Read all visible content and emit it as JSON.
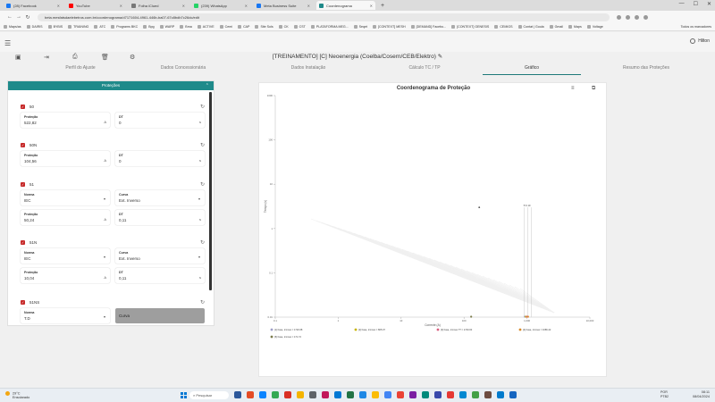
{
  "browser": {
    "tabs": [
      {
        "label": "(28) Facebook",
        "color": "#1877f2",
        "active": false
      },
      {
        "label": "YouTube",
        "color": "#ff0000",
        "active": false
      },
      {
        "label": "Folha iClued",
        "color": "#777777",
        "active": false
      },
      {
        "label": "(239) WhatsApp",
        "color": "#25d366",
        "active": false
      },
      {
        "label": "Meta Business Suite",
        "color": "#1877f2",
        "active": false
      },
      {
        "label": "Coordenograma",
        "color": "#1f8a8a",
        "active": true
      }
    ],
    "url": "beta.mesfatsdaelebetros.com.br/coordenograma/d7171604-4961-446b-ba07-67c8bdb7c26dc/edit",
    "bookmarks": [
      "Maps/as",
      "DAIRIS",
      "BYBIS",
      "TRAINING",
      "ATC",
      "Programs BKC",
      "Bpg",
      "WARP",
      "Bma",
      "ACTIVE",
      "Cemi",
      "CAP",
      "Site Sols",
      "CK",
      "CST",
      "PLATAFORMA MEG...",
      "Seqet",
      "[CONTEXT] MESH",
      "[DEMAND] Facebo...",
      "[CONTEXT] GENESIS",
      "CEMIGS",
      "Contat | Goula",
      "Gmail",
      "Maps",
      "Voltage"
    ],
    "bookmarks_right": "Todos os marcadores"
  },
  "app": {
    "user": "Hilton",
    "project_title": "[TREINAMENTO] [C] Neoenergia (Coelba/Cosern/CEB/Elektro)",
    "tabs": [
      {
        "label": "Perfil do Ajuste",
        "active": false
      },
      {
        "label": "Dados Concessionária",
        "active": false
      },
      {
        "label": "Dados Instalação",
        "active": false
      },
      {
        "label": "Cálculo TC / TP",
        "active": false
      },
      {
        "label": "Gráfico",
        "active": true
      },
      {
        "label": "Resumo das Proteções",
        "active": false
      }
    ]
  },
  "panel": {
    "title": "Proteções",
    "sections": [
      {
        "name": "50",
        "fields": [
          {
            "label": "Proteção",
            "value": "522,82",
            "unit": "A"
          },
          {
            "label": "DT",
            "value": "0",
            "unit": "s"
          }
        ]
      },
      {
        "name": "50N",
        "fields": [
          {
            "label": "Proteção",
            "value": "104,56",
            "unit": "A"
          },
          {
            "label": "DT",
            "value": "0",
            "unit": "s"
          }
        ]
      },
      {
        "name": "51",
        "fields": [
          {
            "label": "Norma",
            "value": "IEC",
            "unit": ""
          },
          {
            "label": "Curva",
            "value": "Ext. Inverso",
            "unit": ""
          },
          {
            "label": "Proteção",
            "value": "50,24",
            "unit": "A"
          },
          {
            "label": "DT",
            "value": "0,11",
            "unit": "s"
          }
        ]
      },
      {
        "name": "51N",
        "fields": [
          {
            "label": "Norma",
            "value": "IEC",
            "unit": ""
          },
          {
            "label": "Curva",
            "value": "Ext. Inverso",
            "unit": ""
          },
          {
            "label": "Proteção",
            "value": "10,04",
            "unit": "A"
          },
          {
            "label": "DT",
            "value": "0,11",
            "unit": "s"
          }
        ]
      },
      {
        "name": "51NS",
        "fields": [
          {
            "label": "Norma",
            "value": "T.D",
            "unit": ""
          },
          {
            "label": "Curva",
            "value": "",
            "unit": ""
          }
        ]
      }
    ]
  },
  "chart_data": {
    "type": "scatter",
    "title": "Coordenograma de Proteção",
    "xlabel": "Corrente (A)",
    "ylabel": "Tempo (s)",
    "x_scale": "log",
    "y_scale": "log",
    "xlim": [
      0.1,
      10000
    ],
    "ylim": [
      0.01,
      1000
    ],
    "x_ticks": [
      "0.1",
      "1",
      "10",
      "100",
      "1,000",
      "10,000"
    ],
    "y_ticks": [
      "0.01",
      "0.1",
      "1",
      "10",
      "100",
      "1000"
    ],
    "grid": false,
    "annotation": "5 6 10",
    "series": [
      {
        "name": "[1] Fase, Iccmax = 1720.68",
        "color": "#9e9ec8",
        "points": [
          [
            1000,
            0.01
          ]
        ]
      },
      {
        "name": "[2] Fase, Iccmax = 805.07",
        "color": "#c8b400",
        "points": [
          [
            1000,
            0.02
          ]
        ]
      },
      {
        "name": "[3] Fase, Iccmax TT = 1740.00",
        "color": "#d86080",
        "points": [
          [
            1000,
            0.015
          ]
        ]
      },
      {
        "name": "[4] Fase, Iccmax = 1686.22",
        "color": "#d88a2a",
        "points": [
          [
            1000,
            0.012
          ]
        ]
      },
      {
        "name": "[5] Fase, Iccmax = 171.72",
        "color": "#7a7a4a",
        "points": [
          [
            120,
            0.01
          ]
        ]
      }
    ],
    "legend_placement": "bottom"
  },
  "taskbar": {
    "weather_temp": "29°C",
    "weather_desc": "Ensolarado",
    "search_placeholder": "Pesquisar",
    "lang": "POR",
    "lang2": "PTB2",
    "time": "08:11",
    "date": "08/04/2024"
  }
}
